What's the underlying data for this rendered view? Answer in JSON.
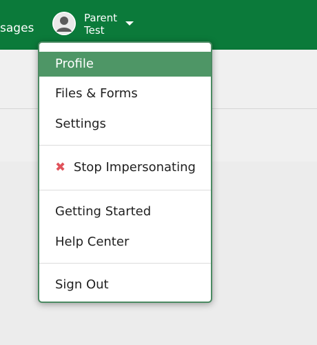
{
  "header": {
    "nav_partial_label": "sages",
    "user": {
      "name_line1": "Parent",
      "name_line2": "Test"
    }
  },
  "menu": {
    "items": [
      {
        "label": "Profile",
        "active": true
      },
      {
        "label": "Files & Forms"
      },
      {
        "label": "Settings"
      },
      {
        "label": "Stop Impersonating",
        "icon": "close-icon"
      },
      {
        "label": "Getting Started"
      },
      {
        "label": "Help Center"
      },
      {
        "label": "Sign Out"
      }
    ]
  },
  "colors": {
    "brand_green": "#0b7a3a",
    "menu_active": "#4e9666",
    "stop_icon": "#e0535b"
  }
}
